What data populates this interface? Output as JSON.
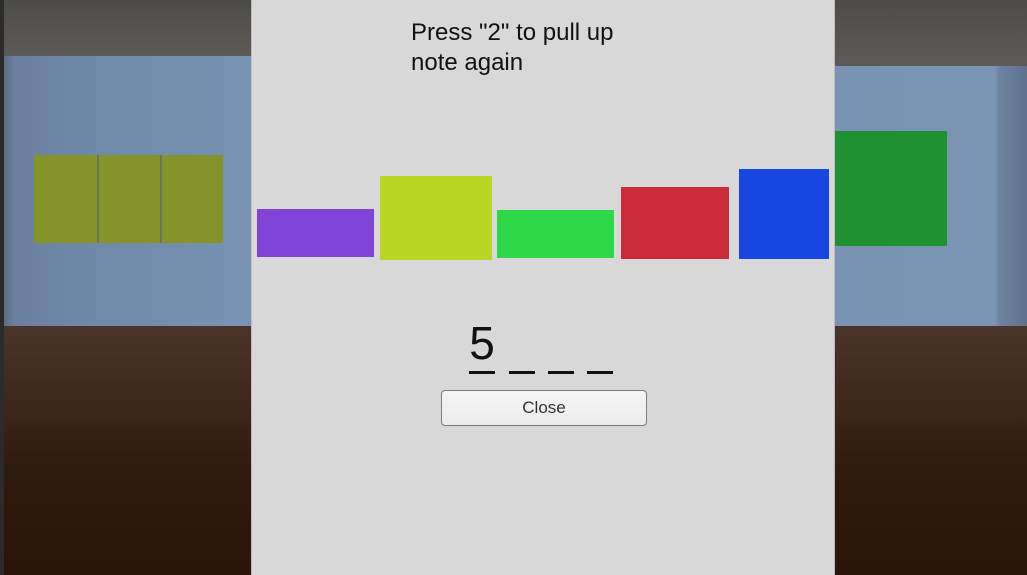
{
  "note": {
    "instruction": "Press \"2\" to pull up\nnote again",
    "color_sequence": [
      {
        "name": "purple",
        "hex": "#8044d8"
      },
      {
        "name": "yellow-green",
        "hex": "#b9d625"
      },
      {
        "name": "green",
        "hex": "#2ed848"
      },
      {
        "name": "red",
        "hex": "#ca2c39"
      },
      {
        "name": "blue",
        "hex": "#1846e0"
      }
    ],
    "code_digits": [
      "5",
      "",
      "",
      ""
    ],
    "close_label": "Close"
  },
  "scene": {
    "left_wall_panel_color": "#84932a",
    "right_wall_panel_color": "#1f9132"
  }
}
